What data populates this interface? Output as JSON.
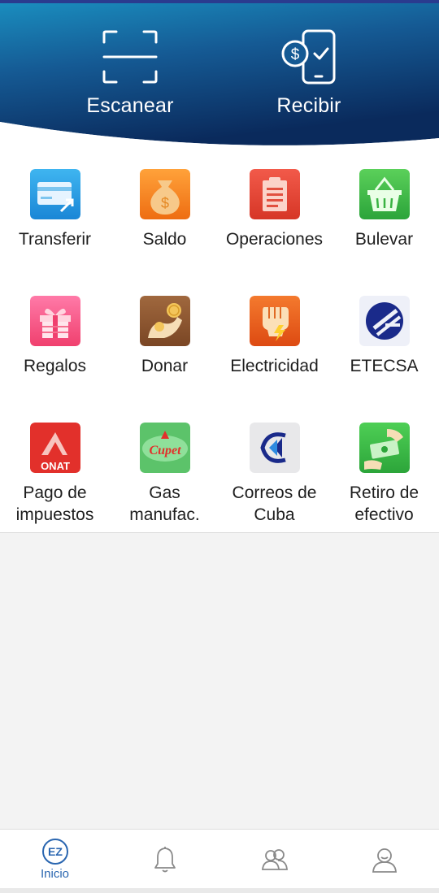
{
  "header": {
    "scan_label": "Escanear",
    "receive_label": "Recibir",
    "colors": {
      "top": "#1a86b8",
      "bottom": "#0a2f63"
    }
  },
  "services": [
    {
      "label": "Transferir",
      "icon": "transfer-card-icon"
    },
    {
      "label": "Saldo",
      "icon": "money-bag-icon"
    },
    {
      "label": "Operaciones",
      "icon": "clipboard-icon"
    },
    {
      "label": "Bulevar",
      "icon": "shopping-basket-icon"
    },
    {
      "label": "Regalos",
      "icon": "gift-icon"
    },
    {
      "label": "Donar",
      "icon": "donate-hand-icon"
    },
    {
      "label": "Electricidad",
      "icon": "electric-fist-icon"
    },
    {
      "label": "ETECSA",
      "icon": "etecsa-logo-icon"
    },
    {
      "label": "Pago de impuestos",
      "icon": "onat-logo-icon"
    },
    {
      "label": "Gas manufac.",
      "icon": "cupet-logo-icon"
    },
    {
      "label": "Correos de Cuba",
      "icon": "correos-logo-icon"
    },
    {
      "label": "Retiro de efectivo",
      "icon": "cash-withdraw-icon"
    }
  ],
  "logos": {
    "onat": "ONAT",
    "cupet": "Cupet"
  },
  "bottom_nav": {
    "home_label": "Inicio",
    "home_icon_text": "EZ",
    "items": [
      "home-icon",
      "bell-icon",
      "contacts-icon",
      "profile-icon"
    ]
  }
}
